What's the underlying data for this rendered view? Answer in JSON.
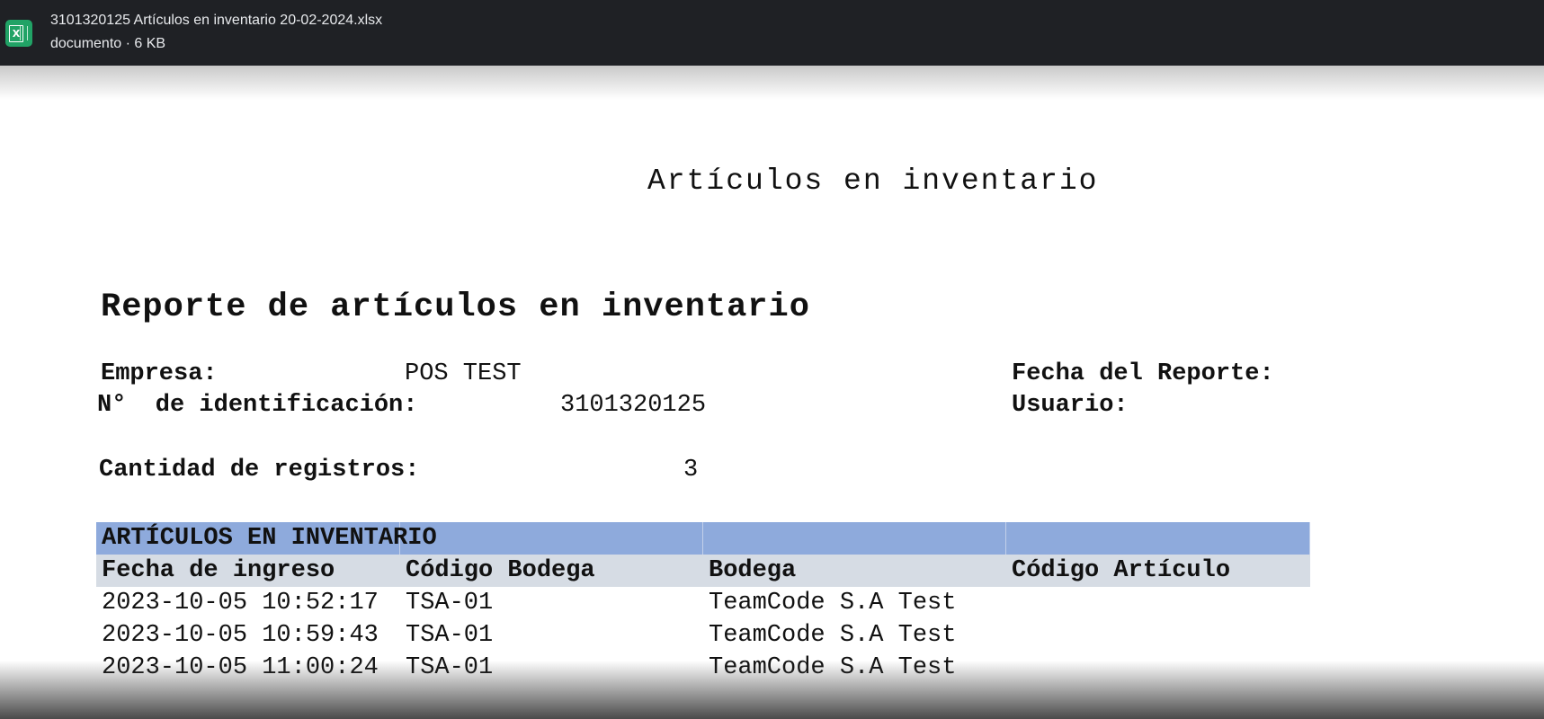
{
  "viewer": {
    "file_name": "3101320125 Artículos en inventario 20-02-2024.xlsx",
    "file_meta": "documento · 6 KB",
    "icon": "excel-icon",
    "bar_color": "#1f2125",
    "icon_color": "#21a366"
  },
  "document": {
    "title": "Artículos en inventario",
    "heading": "Reporte de artículos en inventario",
    "fields": {
      "empresa_label": "Empresa:",
      "empresa_value": "POS TEST",
      "identificacion_label": "N°  de identificación:",
      "identificacion_value": "3101320125",
      "fecha_label": "Fecha del Reporte:",
      "usuario_label": "Usuario:",
      "cantidad_label": "Cantidad de registros:",
      "cantidad_value": "3"
    },
    "table": {
      "section_title": "ARTÍCULOS EN INVENTARIO",
      "section_color": "#8eaadc",
      "header_color": "#d6dce4",
      "columns": [
        "Fecha de ingreso",
        "Código Bodega",
        "Bodega",
        "Código Artículo"
      ],
      "rows": [
        [
          "2023-10-05 10:52:17",
          "TSA-01",
          "TeamCode S.A Test",
          ""
        ],
        [
          "2023-10-05 10:59:43",
          "TSA-01",
          "TeamCode S.A Test",
          ""
        ],
        [
          "2023-10-05 11:00:24",
          "TSA-01",
          "TeamCode S.A Test",
          ""
        ]
      ]
    }
  }
}
